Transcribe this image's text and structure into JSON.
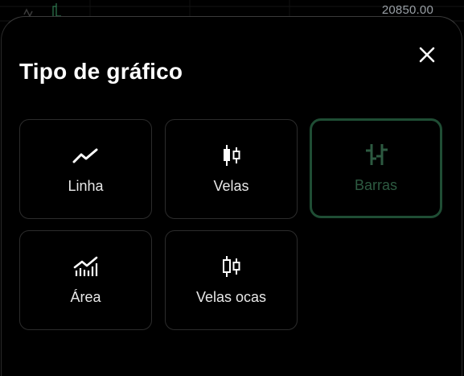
{
  "chart": {
    "price_label": "20850.00"
  },
  "sheet": {
    "title": "Tipo de gráfico",
    "close_icon": "close-icon"
  },
  "chart_types": [
    {
      "id": "line",
      "label": "Linha",
      "icon": "line-chart-icon",
      "selected": false
    },
    {
      "id": "candles",
      "label": "Velas",
      "icon": "candlestick-icon",
      "selected": false
    },
    {
      "id": "bars",
      "label": "Barras",
      "icon": "bar-ohlc-icon",
      "selected": true
    },
    {
      "id": "area",
      "label": "Área",
      "icon": "area-chart-icon",
      "selected": false
    },
    {
      "id": "hollow-candles",
      "label": "Velas ocas",
      "icon": "hollow-candlestick-icon",
      "selected": false
    }
  ],
  "colors": {
    "background": "#000000",
    "card_border": "#2c2c2c",
    "selected_border": "#1f4d34",
    "selected_text": "#2d5a41",
    "text": "#e8e8e8",
    "price_text": "#9aa0a6"
  }
}
